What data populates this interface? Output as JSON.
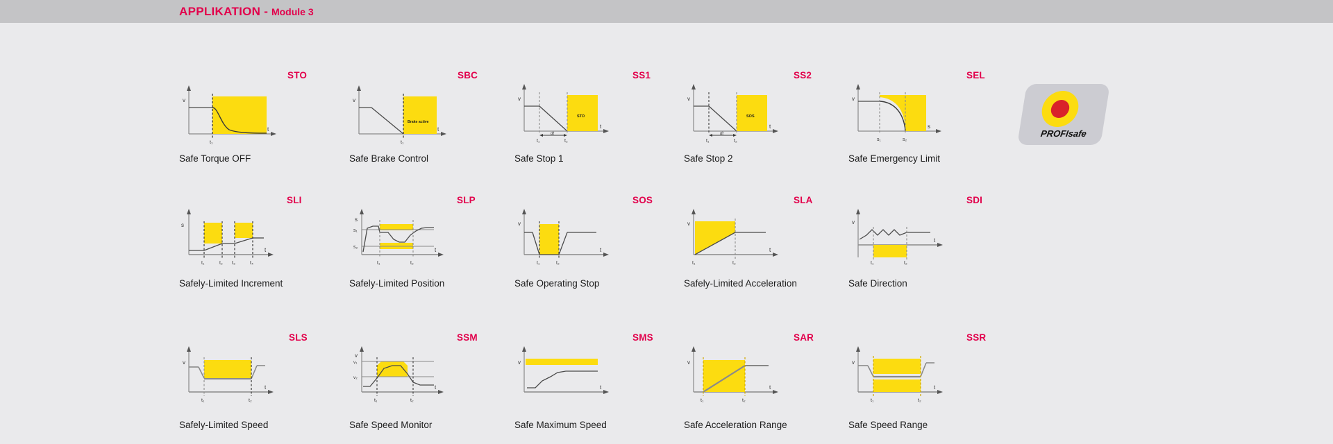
{
  "header": {
    "title": "APPLIKATION",
    "separator": "-",
    "subtitle": "Module 3"
  },
  "colors": {
    "accent": "#e2004b",
    "highlight": "#fcdc10",
    "header_bar": "#c4c4c6",
    "page_bg": "#eaeaec",
    "axis": "#8a8a8a",
    "curve": "#4a4a4a",
    "text": "#1c1c1c"
  },
  "logo": {
    "name": "PROFIsafe",
    "label": "PROFIsafe"
  },
  "functions": [
    {
      "code": "STO",
      "caption": "Safe Torque OFF",
      "yaxis": "v",
      "xaxis": "t",
      "ticks": [
        "t₁"
      ],
      "inner_label": ""
    },
    {
      "code": "SBC",
      "caption": "Safe Brake Control",
      "yaxis": "v",
      "xaxis": "t",
      "ticks": [
        "t₁"
      ],
      "inner_label": "Brake active"
    },
    {
      "code": "SS1",
      "caption": "Safe Stop 1",
      "yaxis": "v",
      "xaxis": "t",
      "ticks": [
        "t₁",
        "dt",
        "t₂"
      ],
      "inner_label": "STO"
    },
    {
      "code": "SS2",
      "caption": "Safe Stop 2",
      "yaxis": "v",
      "xaxis": "t",
      "ticks": [
        "t₁",
        "dt",
        "t₂"
      ],
      "inner_label": "SOS"
    },
    {
      "code": "SEL",
      "caption": "Safe Emergency Limit",
      "yaxis": "v",
      "xaxis": "s",
      "ticks": [
        "s₁",
        "s₂"
      ],
      "inner_label": ""
    },
    {
      "code": "SLI",
      "caption": "Safely-Limited Increment",
      "yaxis": "s",
      "xaxis": "t",
      "ticks": [
        "t₁",
        "t₂",
        "t₃",
        "t₄"
      ],
      "inner_label": ""
    },
    {
      "code": "SLP",
      "caption": "Safely-Limited Position",
      "yaxis": "s",
      "xaxis": "t",
      "ticks": [
        "t₁",
        "t₂"
      ],
      "ylabels": [
        "s₁",
        "s₂"
      ],
      "inner_label": ""
    },
    {
      "code": "SOS",
      "caption": "Safe Operating Stop",
      "yaxis": "v",
      "xaxis": "t",
      "ticks": [
        "t₁",
        "t₂"
      ],
      "inner_label": ""
    },
    {
      "code": "SLA",
      "caption": "Safely-Limited Acceleration",
      "yaxis": "v",
      "xaxis": "t",
      "ticks": [
        "t₁",
        "t₂"
      ],
      "inner_label": ""
    },
    {
      "code": "SDI",
      "caption": "Safe Direction",
      "yaxis": "v",
      "xaxis": "t",
      "ticks": [
        "t₁",
        "t₂"
      ],
      "inner_label": ""
    },
    {
      "code": "SLS",
      "caption": "Safely-Limited Speed",
      "yaxis": "v",
      "xaxis": "t",
      "ticks": [
        "t₁",
        "t₂"
      ],
      "inner_label": ""
    },
    {
      "code": "SSM",
      "caption": "Safe Speed Monitor",
      "yaxis": "v",
      "xaxis": "t",
      "ticks": [
        "t₁",
        "t₂"
      ],
      "ylabels": [
        "v₁",
        "v₂"
      ],
      "inner_label": ""
    },
    {
      "code": "SMS",
      "caption": "Safe Maximum Speed",
      "yaxis": "v",
      "xaxis": "t",
      "ticks": [],
      "inner_label": ""
    },
    {
      "code": "SAR",
      "caption": "Safe Acceleration Range",
      "yaxis": "v",
      "xaxis": "t",
      "ticks": [
        "t₁",
        "t₂"
      ],
      "inner_label": ""
    },
    {
      "code": "SSR",
      "caption": "Safe Speed Range",
      "yaxis": "v",
      "xaxis": "t",
      "ticks": [
        "t₁",
        "t₂"
      ],
      "inner_label": ""
    }
  ]
}
